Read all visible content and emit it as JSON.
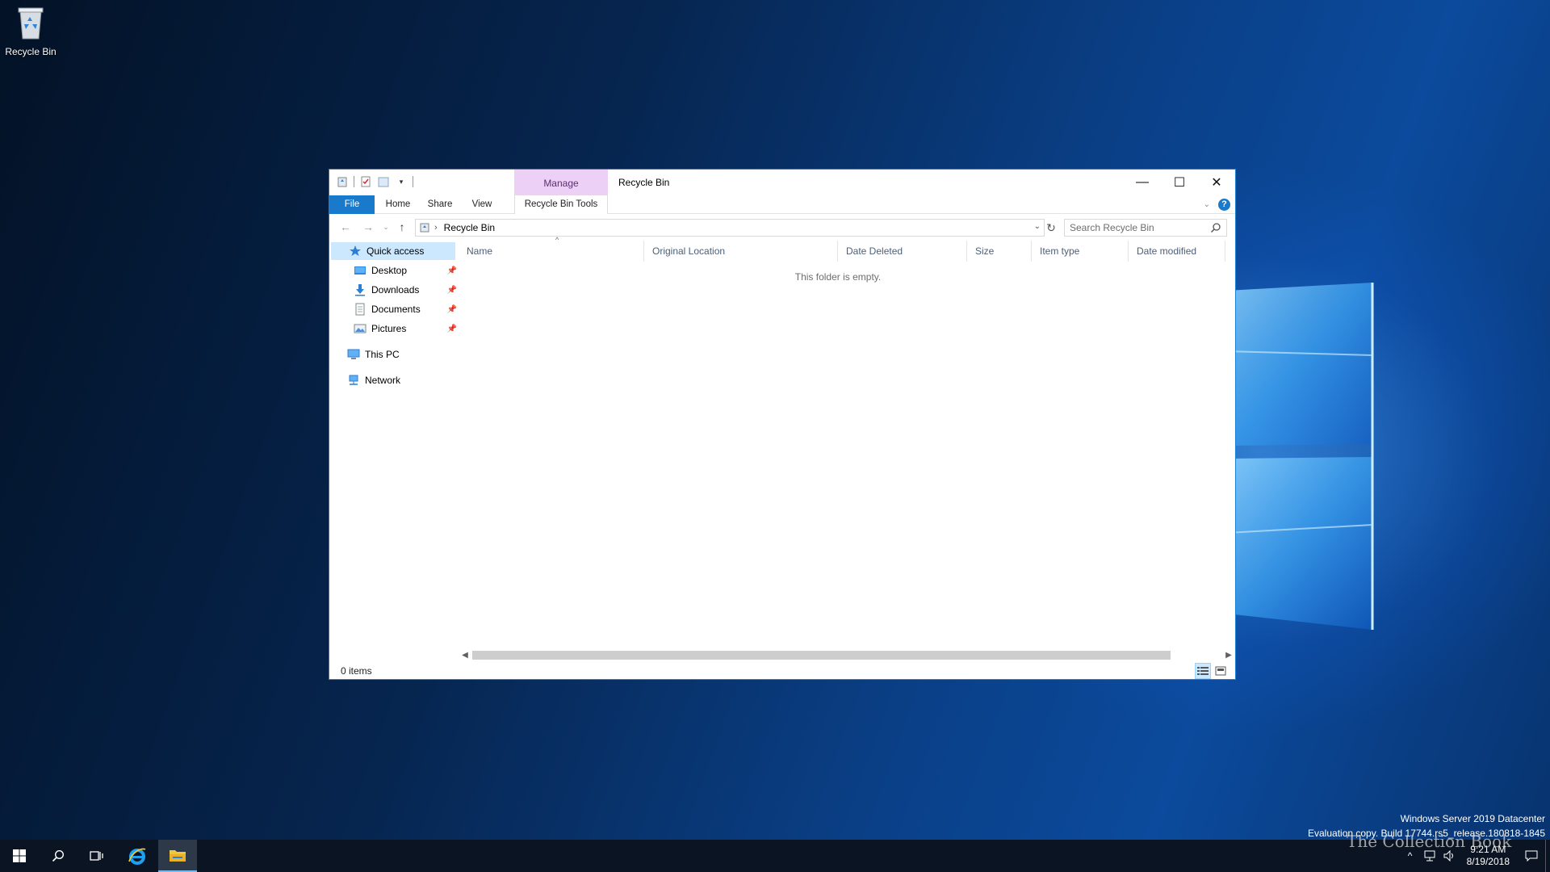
{
  "desktop": {
    "icons": [
      {
        "label": "Recycle Bin",
        "icon": "recycle-bin-icon"
      }
    ]
  },
  "window": {
    "title": "Recycle Bin",
    "context_tab_group": "Manage",
    "qat_icons": [
      "recycle-bin-small-icon",
      "properties-icon",
      "new-folder-icon",
      "customize-qat-icon"
    ],
    "caption": {
      "minimize": "—",
      "maximize": "☐",
      "close": "✕"
    },
    "ribbon_tabs": {
      "file": "File",
      "home": "Home",
      "share": "Share",
      "view": "View",
      "recycle_bin_tools": "Recycle Bin Tools"
    },
    "address": {
      "path": "Recycle Bin"
    },
    "search": {
      "placeholder": "Search Recycle Bin"
    },
    "nav_pane": {
      "quick_access": "Quick access",
      "pinned": [
        {
          "label": "Desktop",
          "icon": "desktop-folder-icon"
        },
        {
          "label": "Downloads",
          "icon": "downloads-folder-icon"
        },
        {
          "label": "Documents",
          "icon": "documents-folder-icon"
        },
        {
          "label": "Pictures",
          "icon": "pictures-folder-icon"
        }
      ],
      "this_pc": "This PC",
      "network": "Network"
    },
    "columns": [
      "Name",
      "Original Location",
      "Date Deleted",
      "Size",
      "Item type",
      "Date modified"
    ],
    "empty_message": "This folder is empty.",
    "status": "0 items"
  },
  "watermark": {
    "line1": "Windows Server 2019 Datacenter",
    "line2": "Evaluation copy. Build 17744.rs5_release.180818-1845"
  },
  "taskbar": {
    "buttons": [
      "start-icon",
      "search-icon",
      "task-view-icon",
      "internet-explorer-icon",
      "file-explorer-icon"
    ],
    "clock_time": "9:21 AM",
    "clock_date": "8/19/2018",
    "overlay_text": "The Collection Book"
  },
  "colors": {
    "accent": "#1979ca",
    "context_tab": "#ecd0f6",
    "taskbar": "#0b1422"
  }
}
